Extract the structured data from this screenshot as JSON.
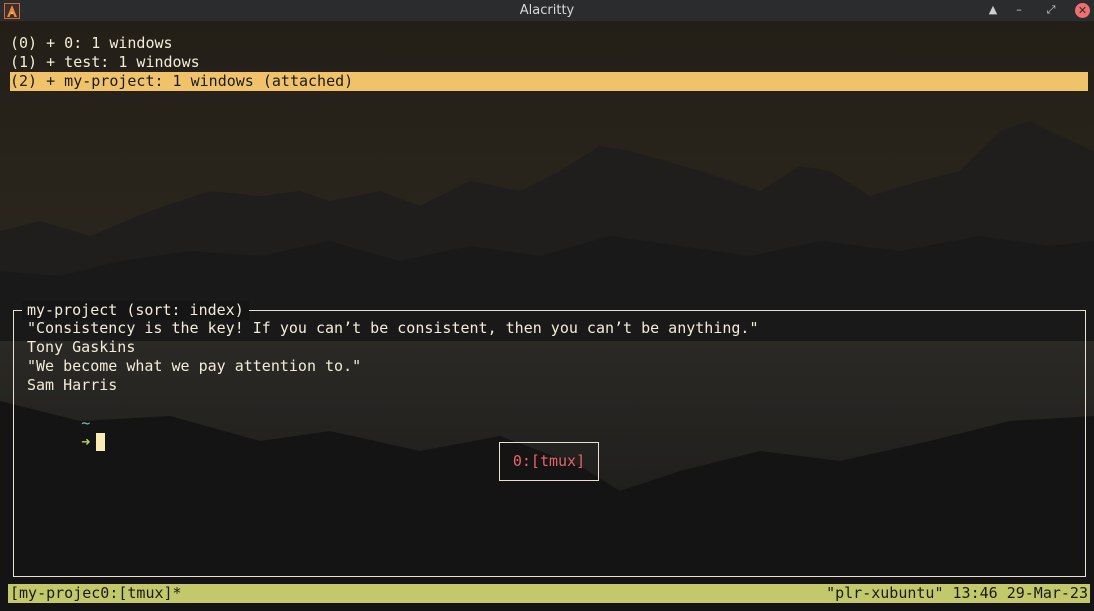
{
  "window": {
    "title": "Alacritty",
    "icon": "alacritty-icon",
    "buttons": {
      "shade": "▲",
      "minimize": "–",
      "maximize": "⤢",
      "close": "✕"
    }
  },
  "sessions": [
    {
      "text": "(0) + 0: 1 windows",
      "selected": false
    },
    {
      "text": "(1) + test: 1 windows",
      "selected": false
    },
    {
      "text": "(2) + my-project: 1 windows (attached)",
      "selected": true
    }
  ],
  "preview": {
    "title": "my-project (sort: index)",
    "lines": [
      "\"Consistency is the key! If you can’t be consistent, then you can’t be anything.\"",
      "Tony Gaskins",
      "\"We become what we pay attention to.\"",
      "Sam Harris"
    ],
    "prompt": {
      "tilde": "~",
      "arrow": "➜"
    },
    "window_label": "0:[tmux]"
  },
  "statusbar": {
    "left": "[my-projec0:[tmux]*",
    "right": "\"plr-xubuntu\" 13:46 29-Mar-23"
  },
  "colors": {
    "selected_bg": "#f0c26a",
    "statusbar_bg": "#c3c86a",
    "window_label": "#e7646a",
    "close_button": "#ef6f73"
  }
}
